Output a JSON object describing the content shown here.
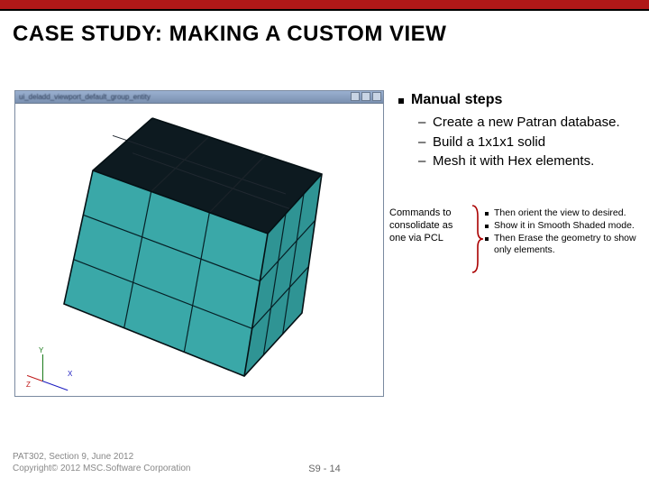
{
  "slide": {
    "title": "CASE STUDY: MAKING A CUSTOM VIEW"
  },
  "viewport": {
    "titlebar_text": "ui_deladd_viewport_default_group_entity",
    "axis": {
      "x": "X",
      "y": "Y",
      "z": "Z"
    },
    "cube": {
      "top_fill": "#0d1a20",
      "front_fill": "#35a0a0",
      "side_fill": "#2a8888",
      "edge": "#041014"
    }
  },
  "bullets": {
    "main": "Manual steps",
    "subs": [
      "Create a new Patran database.",
      "Build a 1x1x1 solid",
      "Mesh it with Hex elements."
    ]
  },
  "commands_label": "Commands to consolidate as one via PCL",
  "mini_bullets": [
    "Then orient the view to desired.",
    "Show it in Smooth Shaded mode.",
    "Then Erase the geometry to show only elements."
  ],
  "footer": {
    "line1": "PAT302, Section 9, June 2012",
    "line2": "Copyright© 2012 MSC.Software Corporation"
  },
  "page_number": "S9 - 14"
}
